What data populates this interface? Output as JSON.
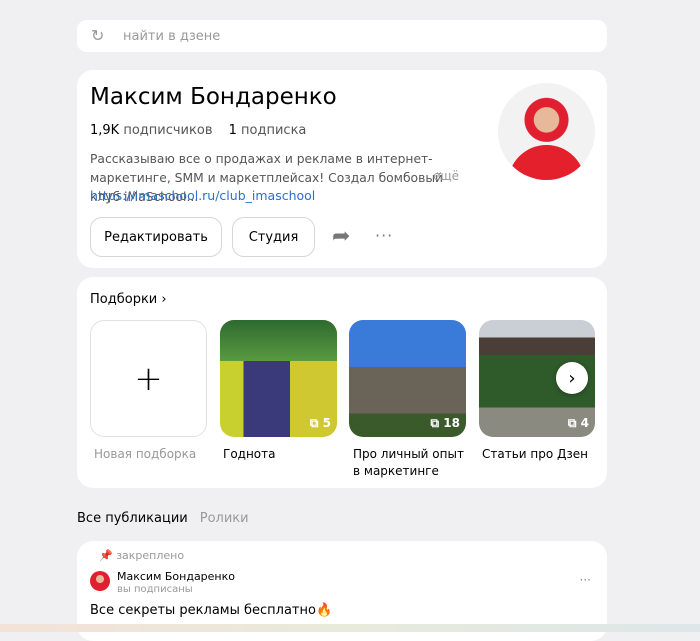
{
  "search": {
    "placeholder": "найти в дзене",
    "icon": "search-icon"
  },
  "profile": {
    "name": "Максим Бондаренко",
    "subscribers_count": "1,9K",
    "subscribers_label": "подписчиков",
    "subscriptions_count": "1",
    "subscriptions_label": "подписка",
    "bio": "Рассказываю все о продажах и рекламе в интернет-маркетинге, SMM и маркетплейсах! Создал бомбовый клуб iMaSchool...",
    "more": "ещё",
    "link": "https://imaschool.ru/club_imaschool",
    "edit_button": "Редактировать",
    "studio_button": "Студия",
    "more_dots": "···"
  },
  "collections": {
    "title": "Подборки",
    "new_label": "Новая подборка",
    "items": [
      {
        "label": "Годнота",
        "count": "5"
      },
      {
        "label": "Про личный опыт в маркетинге",
        "count": "18"
      },
      {
        "label": "Статьи про Дзен",
        "count": "4"
      }
    ]
  },
  "tabs": {
    "all": "Все публикации",
    "videos": "Ролики"
  },
  "post": {
    "pinned": "закреплено",
    "author": "Максим Бондаренко",
    "status": "вы подписаны",
    "text": "Все секреты рекламы бесплатно🔥",
    "dots": "···"
  }
}
